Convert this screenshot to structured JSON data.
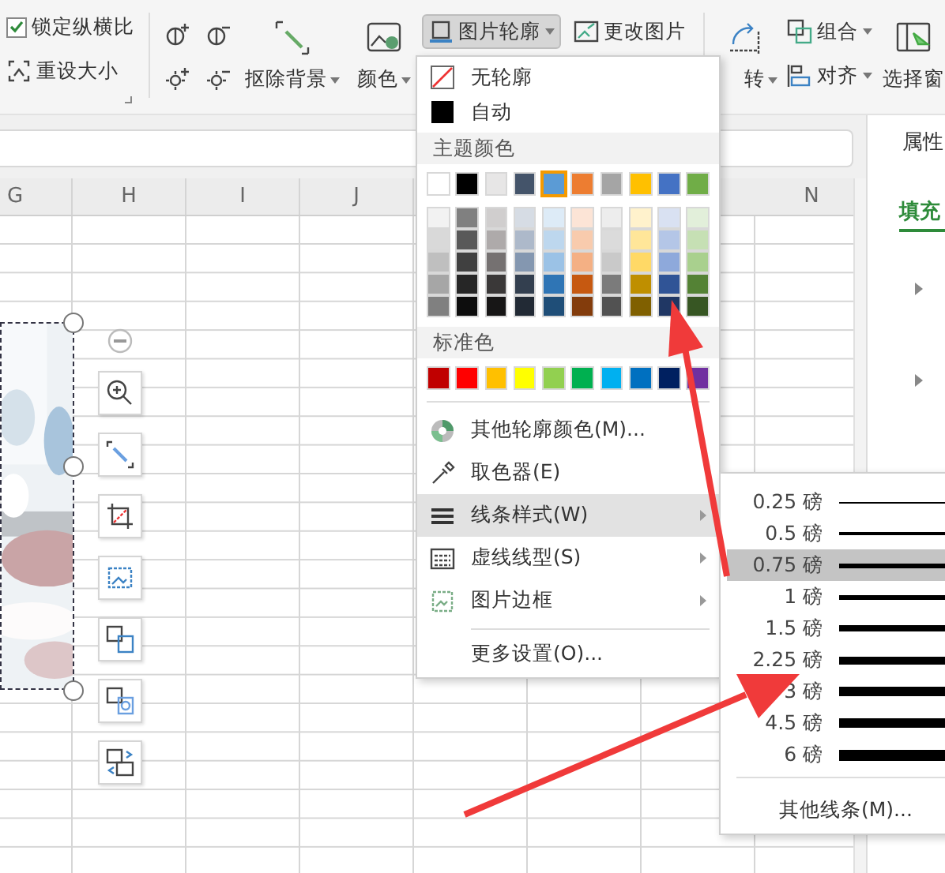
{
  "ribbon": {
    "lock_ratio": {
      "label": "锁定纵横比",
      "checked": true
    },
    "reset_size": {
      "label": "重设大小"
    },
    "remove_background": {
      "label": "抠除背景"
    },
    "color": {
      "label": "颜色"
    },
    "picture_outline": {
      "label": "图片轮廓",
      "pressed": true
    },
    "change_picture": {
      "label": "更改图片"
    },
    "rotate": {
      "label": "转"
    },
    "group": {
      "label": "组合"
    },
    "align": {
      "label": "对齐"
    },
    "selection_pane": {
      "label": "选择窗"
    }
  },
  "sheet": {
    "columns": [
      "G",
      "H",
      "I",
      "J",
      "N"
    ]
  },
  "panel": {
    "title": "属性",
    "tabs": [
      {
        "label": "填充",
        "selected": true
      }
    ]
  },
  "outline_menu": {
    "options": [
      {
        "kind": "none",
        "label": "无轮廓"
      },
      {
        "kind": "auto",
        "label": "自动"
      }
    ],
    "theme_header": "主题颜色",
    "theme_colors": [
      {
        "color": "#ffffff",
        "selected": false
      },
      {
        "color": "#000000",
        "selected": false
      },
      {
        "color": "#e7e6e6",
        "selected": false
      },
      {
        "color": "#44546a",
        "selected": false
      },
      {
        "color": "#5b9bd5",
        "selected": true
      },
      {
        "color": "#ed7d31",
        "selected": false
      },
      {
        "color": "#a5a5a5",
        "selected": false
      },
      {
        "color": "#ffc000",
        "selected": false
      },
      {
        "color": "#4472c4",
        "selected": false
      },
      {
        "color": "#70ad47",
        "selected": false
      }
    ],
    "shades": [
      [
        {
          "color": "#f2f2f2"
        },
        {
          "color": "#808080"
        },
        {
          "color": "#d0cece"
        },
        {
          "color": "#d6dce4"
        },
        {
          "color": "#ddebf7"
        },
        {
          "color": "#fce4d6"
        },
        {
          "color": "#ededed"
        },
        {
          "color": "#fff2cc"
        },
        {
          "color": "#d9e1f2"
        },
        {
          "color": "#e2efda"
        }
      ],
      [
        {
          "color": "#d9d9d9"
        },
        {
          "color": "#595959"
        },
        {
          "color": "#aeaaaa"
        },
        {
          "color": "#adb9ca"
        },
        {
          "color": "#bdd7ee"
        },
        {
          "color": "#f8cbad"
        },
        {
          "color": "#dbdbdb"
        },
        {
          "color": "#ffe699"
        },
        {
          "color": "#b4c6e7"
        },
        {
          "color": "#c6e0b4"
        }
      ],
      [
        {
          "color": "#bfbfbf"
        },
        {
          "color": "#404040"
        },
        {
          "color": "#757171"
        },
        {
          "color": "#8497b0"
        },
        {
          "color": "#9bc2e6"
        },
        {
          "color": "#f4b084"
        },
        {
          "color": "#c9c9c9"
        },
        {
          "color": "#ffd966"
        },
        {
          "color": "#8ea9db"
        },
        {
          "color": "#a9d08e"
        }
      ],
      [
        {
          "color": "#a6a6a6"
        },
        {
          "color": "#262626"
        },
        {
          "color": "#3a3838"
        },
        {
          "color": "#333f4f"
        },
        {
          "color": "#2f75b5"
        },
        {
          "color": "#c65911"
        },
        {
          "color": "#7b7b7b"
        },
        {
          "color": "#bf8f00"
        },
        {
          "color": "#305496"
        },
        {
          "color": "#548235"
        }
      ],
      [
        {
          "color": "#808080"
        },
        {
          "color": "#0d0d0d"
        },
        {
          "color": "#171616"
        },
        {
          "color": "#222a35"
        },
        {
          "color": "#1f4e78"
        },
        {
          "color": "#833c0c"
        },
        {
          "color": "#525252"
        },
        {
          "color": "#806000"
        },
        {
          "color": "#203764"
        },
        {
          "color": "#375623"
        }
      ]
    ],
    "standard_header": "标准色",
    "standard_colors": [
      {
        "color": "#c00000"
      },
      {
        "color": "#ff0000"
      },
      {
        "color": "#ffc000"
      },
      {
        "color": "#ffff00"
      },
      {
        "color": "#92d050"
      },
      {
        "color": "#00b050"
      },
      {
        "color": "#00b0f0"
      },
      {
        "color": "#0070c0"
      },
      {
        "color": "#002060"
      },
      {
        "color": "#7030a0"
      }
    ],
    "actions": [
      {
        "kind": "more-colors",
        "label": "其他轮廓颜色(M)...",
        "has_submenu": false,
        "highlighted": false
      },
      {
        "kind": "eyedropper",
        "label": "取色器(E)",
        "has_submenu": false,
        "highlighted": false
      },
      {
        "kind": "line-style",
        "label": "线条样式(W)",
        "has_submenu": true,
        "highlighted": true
      },
      {
        "kind": "dash",
        "label": "虚线线型(S)",
        "has_submenu": true,
        "highlighted": false
      },
      {
        "kind": "border",
        "label": "图片边框",
        "has_submenu": true,
        "highlighted": false
      }
    ],
    "more_settings": "更多设置(O)..."
  },
  "line_weight_menu": {
    "weights": [
      {
        "label": "0.25 磅",
        "selected": false
      },
      {
        "label": "0.5 磅",
        "selected": false
      },
      {
        "label": "0.75 磅",
        "selected": true
      },
      {
        "label": "1 磅",
        "selected": false
      },
      {
        "label": "1.5 磅",
        "selected": false
      },
      {
        "label": "2.25 磅",
        "selected": false
      },
      {
        "label": "3 磅",
        "selected": false
      },
      {
        "label": "4.5 磅",
        "selected": false
      },
      {
        "label": "6 磅",
        "selected": false
      }
    ],
    "more_lines": "其他线条(M)..."
  }
}
